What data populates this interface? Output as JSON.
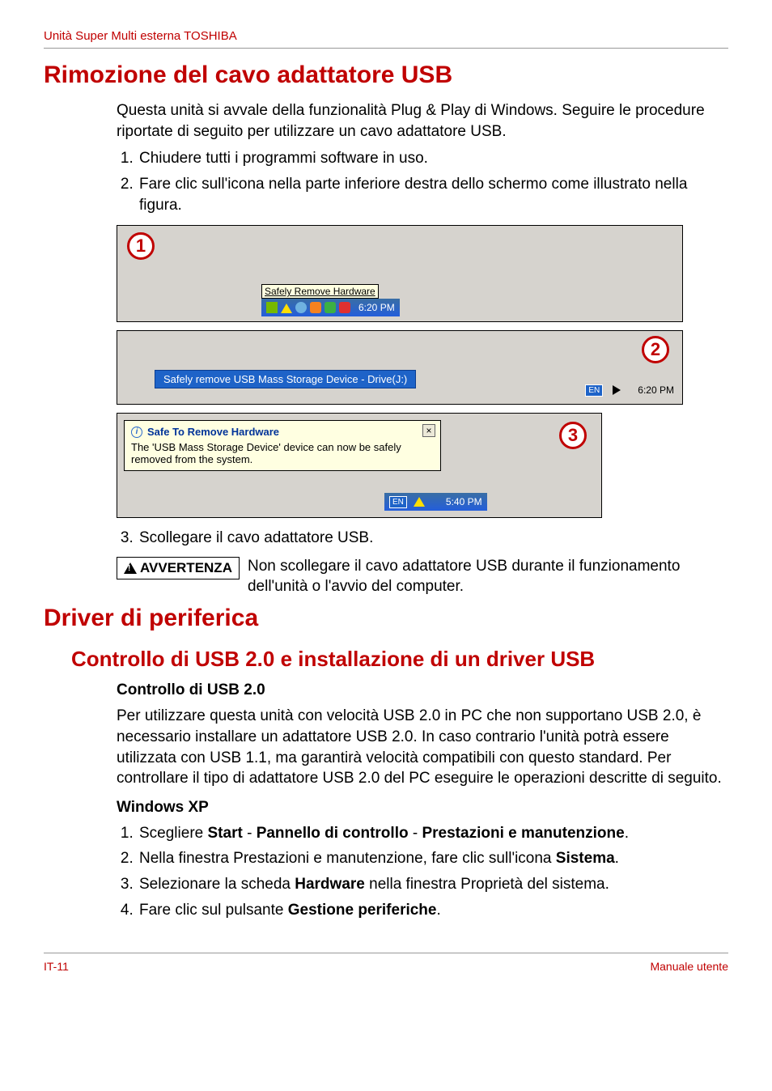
{
  "header": {
    "product_line": "Unità Super Multi esterna TOSHIBA"
  },
  "section1": {
    "title": "Rimozione del cavo adattatore USB",
    "intro": "Questa unità si avvale della funzionalità Plug & Play di Windows. Seguire le procedure riportate di seguito per utilizzare un cavo adattatore USB.",
    "steps_a": [
      "Chiudere tutti i programmi software in uso.",
      "Fare clic sull'icona nella parte inferiore destra dello schermo come illustrato nella figura."
    ],
    "steps_b": [
      "Scollegare il cavo adattatore USB."
    ]
  },
  "screenshots": {
    "callouts": [
      "1",
      "2",
      "3"
    ],
    "shot1": {
      "tooltip": "Safely Remove Hardware",
      "clock": "6:20 PM"
    },
    "shot2": {
      "menu_item": "Safely remove USB Mass Storage Device - Drive(J:)",
      "lang": "EN",
      "clock": "6:20 PM"
    },
    "shot3": {
      "balloon_title": "Safe To Remove Hardware",
      "balloon_body": "The 'USB Mass Storage Device' device can now be safely removed from the system.",
      "close": "×",
      "lang": "EN",
      "clock": "5:40 PM"
    }
  },
  "warning": {
    "label": "AVVERTENZA",
    "text": "Non scollegare il cavo adattatore USB durante il funzionamento dell'unità o l'avvio del computer."
  },
  "section2": {
    "title": "Driver di periferica",
    "sub_title": "Controllo di USB 2.0 e installazione di un driver USB",
    "h_check": "Controllo di USB 2.0",
    "p_check": "Per utilizzare questa unità con velocità USB 2.0 in PC che non supportano USB 2.0, è necessario installare un adattatore USB 2.0. In caso contrario l'unità potrà essere utilizzata con USB 1.1, ma garantirà velocità compatibili con questo standard. Per controllare il tipo di adattatore USB 2.0 del PC eseguire le operazioni descritte di seguito.",
    "h_xp": "Windows XP",
    "xp_steps": {
      "s1_pre": "Scegliere ",
      "s1_b1": "Start",
      "s1_sep": " - ",
      "s1_b2": "Pannello di controllo",
      "s1_b3": "Prestazioni e manutenzione",
      "s1_post": ".",
      "s2_pre": "Nella finestra Prestazioni e manutenzione, fare clic sull'icona ",
      "s2_b": "Sistema",
      "s2_post": ".",
      "s3_pre": "Selezionare la scheda ",
      "s3_b": "Hardware",
      "s3_post": " nella finestra Proprietà del sistema.",
      "s4_pre": "Fare clic sul pulsante ",
      "s4_b": "Gestione periferiche",
      "s4_post": "."
    }
  },
  "footer": {
    "left": "IT-11",
    "right": "Manuale utente"
  }
}
